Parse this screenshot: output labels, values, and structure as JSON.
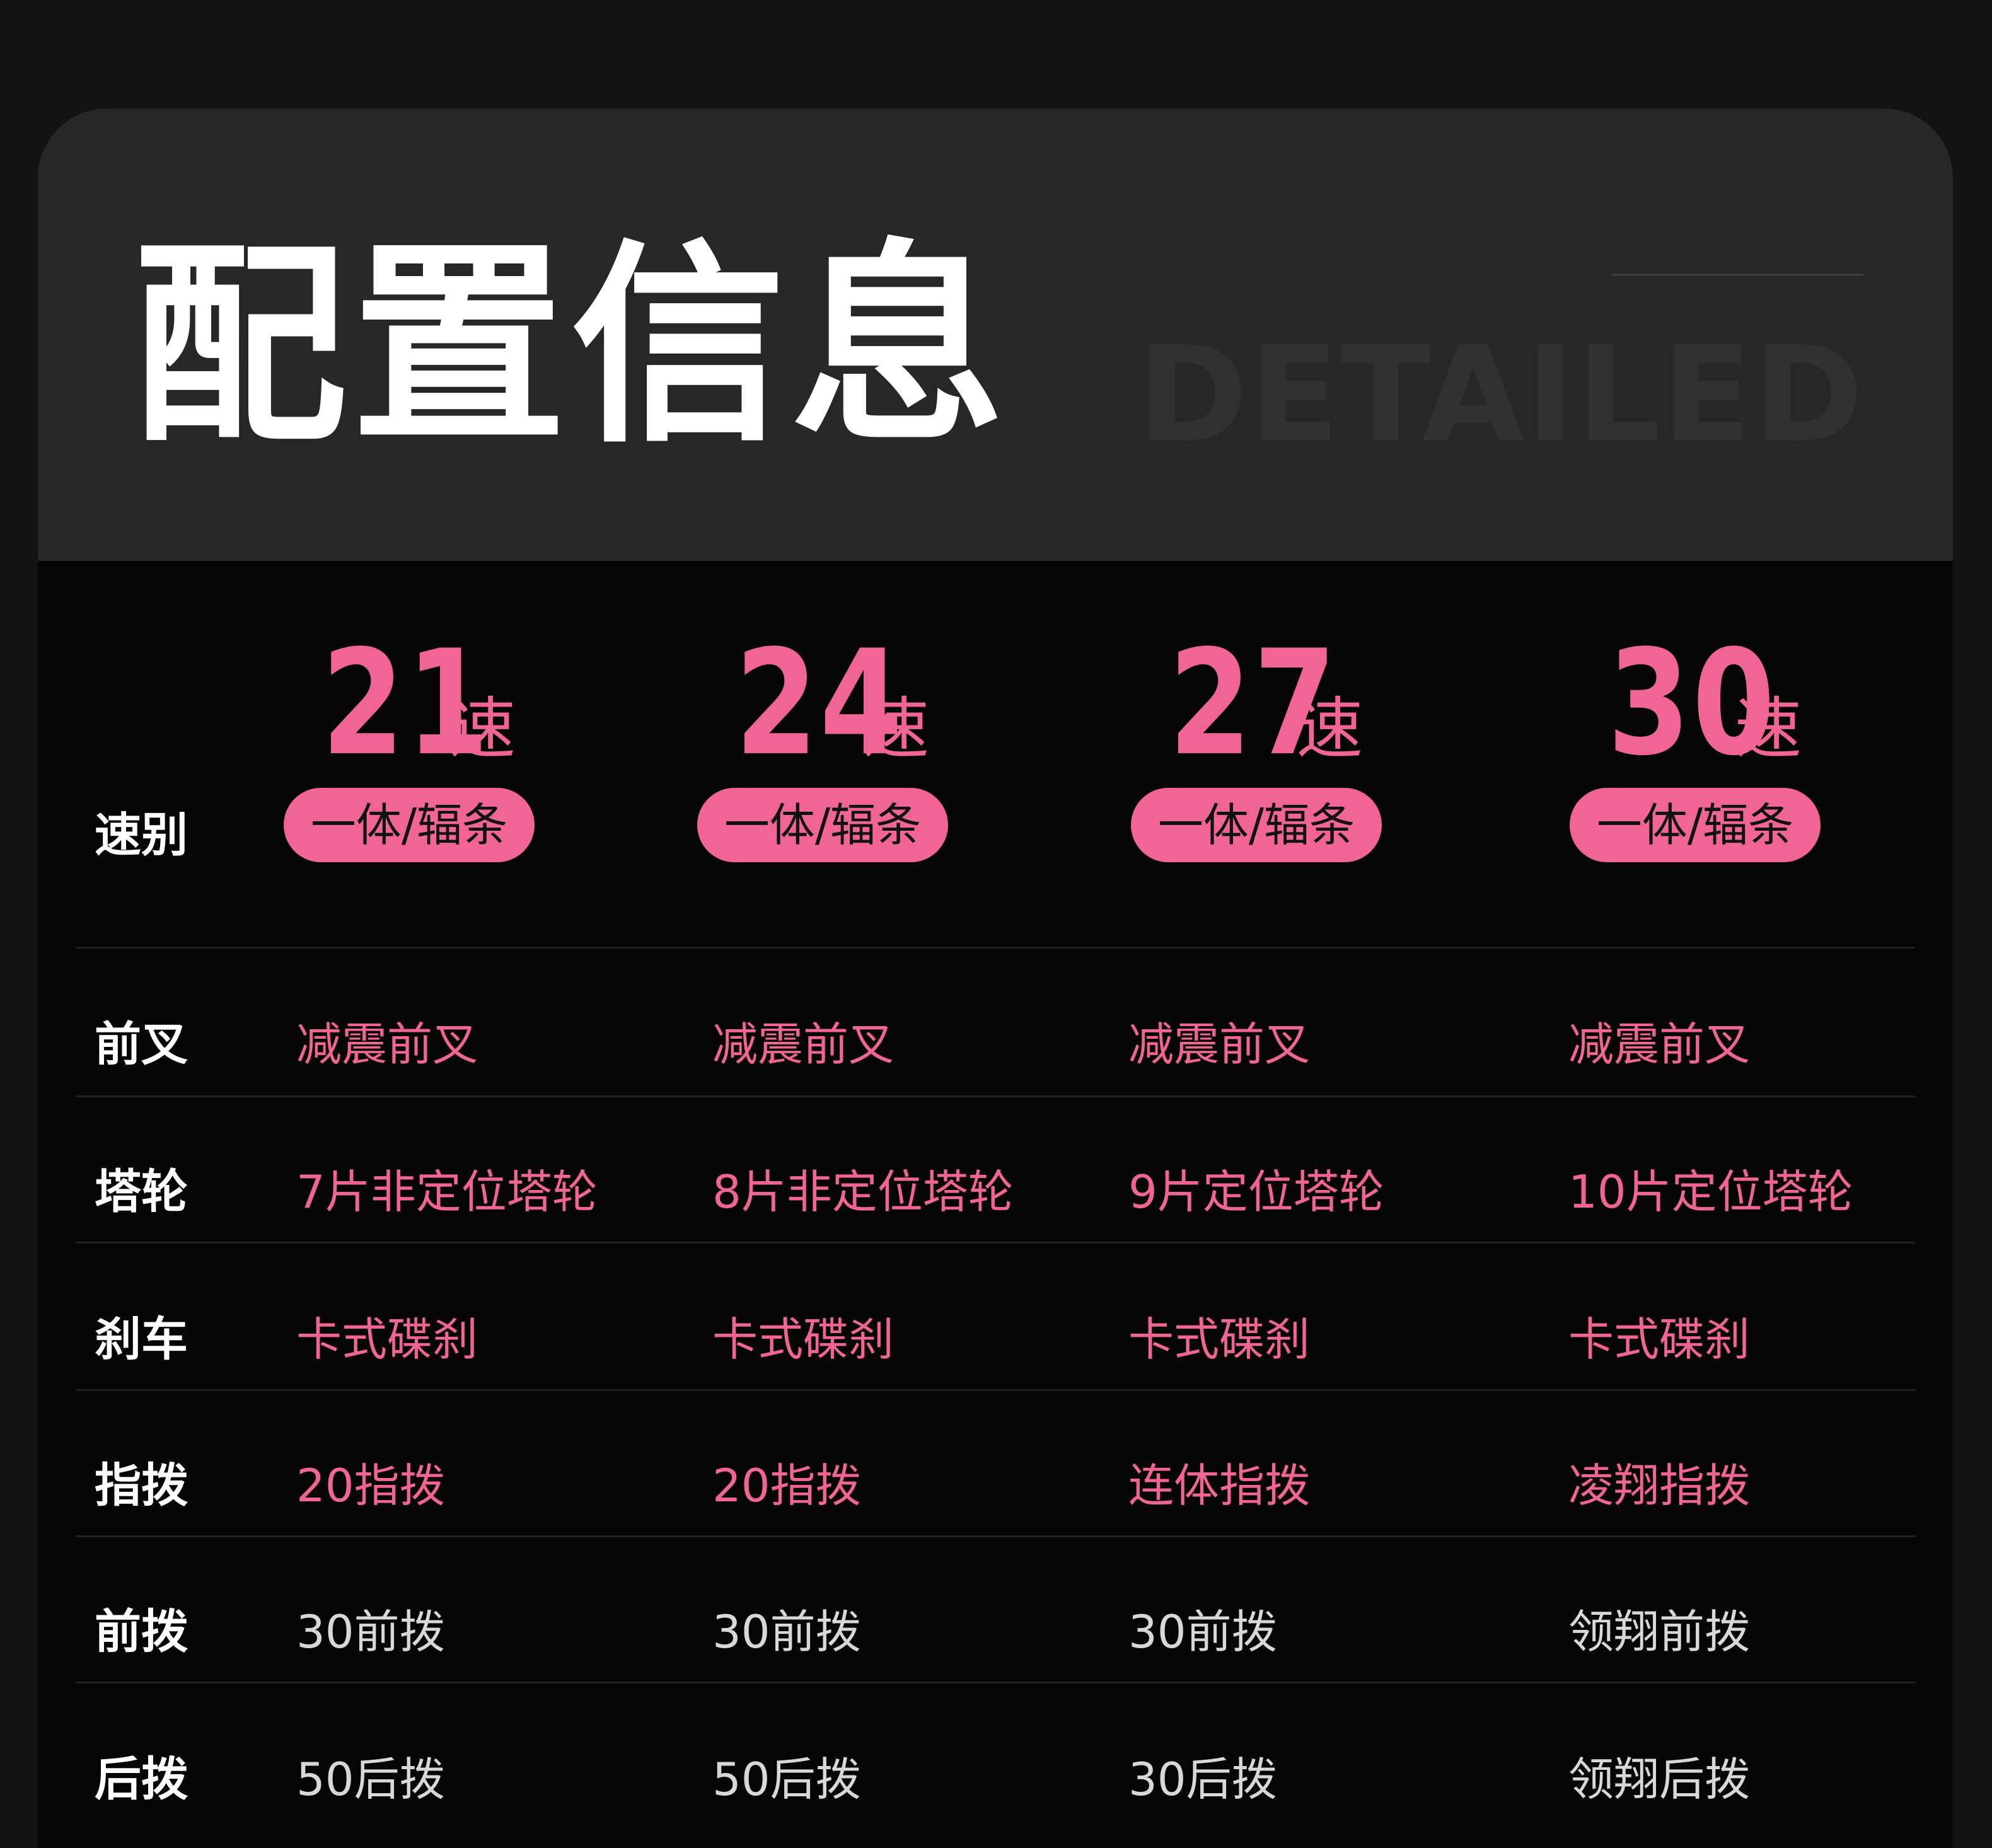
{
  "title": "配置信息",
  "subtitle": "DETAILED",
  "speed_label": "速别",
  "speeds": [
    {
      "number": "21",
      "unit": "速",
      "tag": "一体/辐条"
    },
    {
      "number": "24",
      "unit": "速",
      "tag": "一体/辐条"
    },
    {
      "number": "27",
      "unit": "速",
      "tag": "一体/辐条"
    },
    {
      "number": "30",
      "unit": "速",
      "tag": "一体/辐条"
    }
  ],
  "rows": [
    {
      "label": "前叉",
      "values": [
        "减震前叉",
        "减震前叉",
        "减震前叉",
        "减震前叉"
      ]
    },
    {
      "label": "塔轮",
      "values": [
        "7片非定位塔轮",
        "8片非定位塔轮",
        "9片定位塔轮",
        "10片定位塔轮"
      ]
    },
    {
      "label": "刹车",
      "values": [
        "卡式碟刹",
        "卡式碟刹",
        "卡式碟刹",
        "卡式碟刹"
      ]
    },
    {
      "label": "指拨",
      "values": [
        "20指拨",
        "20指拨",
        "连体指拨",
        "凌翔指拨"
      ]
    },
    {
      "label": "前拨",
      "values": [
        "30前拨",
        "30前拨",
        "30前拨",
        "领翔前拨"
      ]
    },
    {
      "label": "后拨",
      "values": [
        "50后拨",
        "50后拨",
        "30后拨",
        "领翔后拨"
      ]
    }
  ],
  "colors": {
    "accent": "#f06496",
    "background": "#060606",
    "header_background": "#272727",
    "gray_text": "#d8d8d8"
  }
}
